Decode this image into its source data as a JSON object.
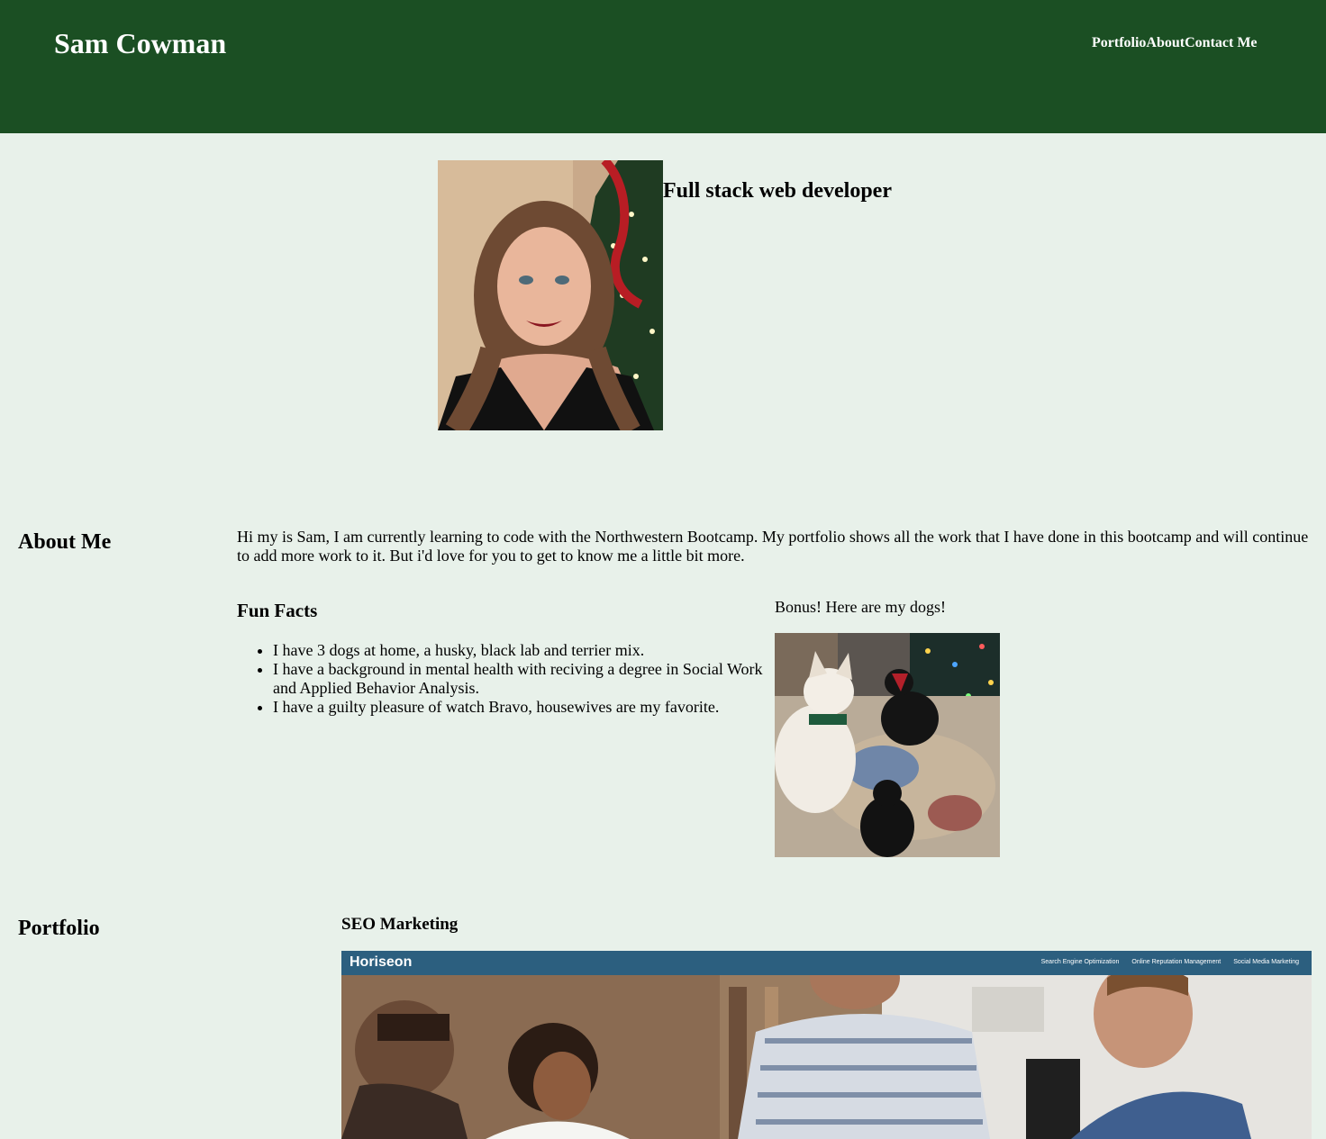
{
  "header": {
    "title": "Sam Cowman",
    "nav": [
      "Portfolio",
      "About",
      "Contact Me"
    ],
    "background": "#1b4f23"
  },
  "hero": {
    "tagline": "Full stack web developer",
    "photo_icon": "profile-photo"
  },
  "about": {
    "heading": "About Me",
    "text": "Hi my is Sam, I am currently learning to code with the Northwestern Bootcamp. My portfolio shows all the work that I have done in this bootcamp and will continue to add more work to it. But i'd love for you to get to know me a little bit more.",
    "fun_facts_heading": "Fun Facts",
    "fun_facts": [
      "I have 3 dogs at home, a husky, black lab and terrier mix.",
      "I have a background in mental health with reciving a degree in Social Work and Applied Behavior Analysis.",
      "I have a guilty pleasure of watch Bravo, housewives are my favorite."
    ],
    "dogs_caption": "Bonus! Here are my dogs!"
  },
  "portfolio": {
    "heading": "Portfolio",
    "projects": [
      {
        "title": "SEO Marketing",
        "screenshot": {
          "brand": "Horiseon",
          "links": [
            "Search Engine Optimization",
            "Online Reputation Management",
            "Social Media Marketing"
          ],
          "nav_color": "#2c5f7f"
        }
      }
    ]
  },
  "colors": {
    "page_background": "#e8f1ea",
    "header_background": "#1b4f23"
  }
}
